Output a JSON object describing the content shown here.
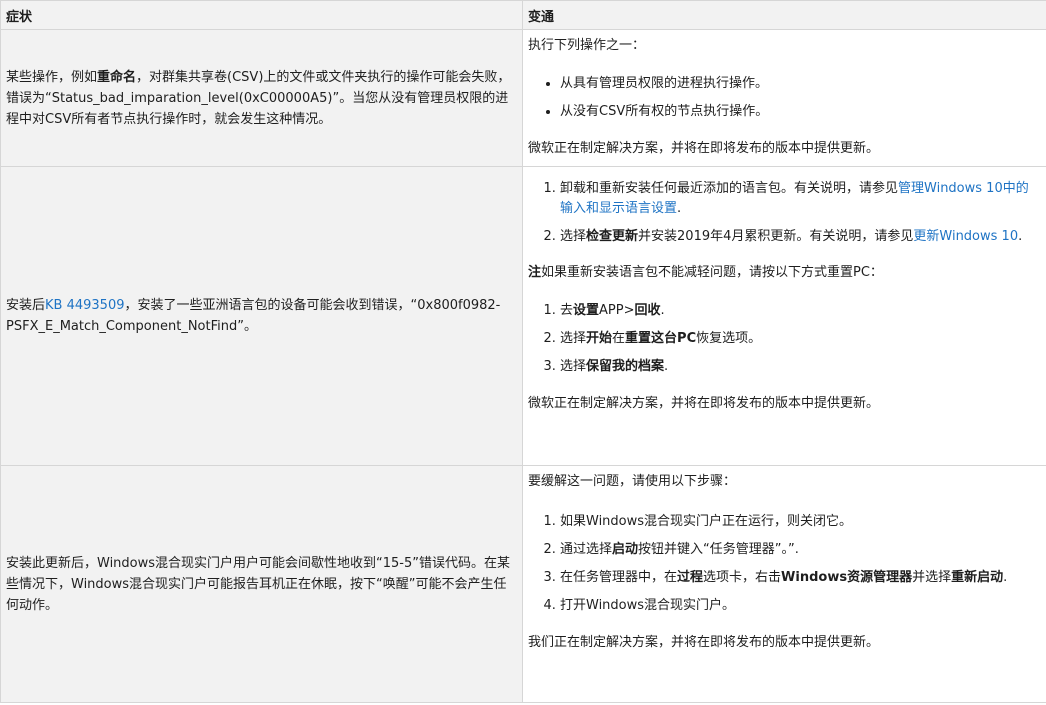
{
  "header": {
    "symptom": "症状",
    "workaround": "变通"
  },
  "row1": {
    "symptom": {
      "a": "某些操作，例如",
      "b": "重命名",
      "c": "，对群集共享卷(CSV)上的文件或文件夹执行的操作可能会失败，错误为“Status_bad_imparation_level(0xC00000A5)”。当您从没有管理员权限的进程中对CSV所有者节点执行操作时，就会发生这种情况。"
    },
    "workaround": {
      "intro": "执行下列操作之一：",
      "bullets": [
        "从具有管理员权限的进程执行操作。",
        "从没有CSV所有权的节点执行操作。"
      ],
      "footer": "微软正在制定解决方案，并将在即将发布的版本中提供更新。"
    }
  },
  "row2": {
    "symptom": {
      "a": "安装后",
      "link": "KB 4493509",
      "b": "，安装了一些亚洲语言包的设备可能会收到错误，“0x800f0982-PSFX_E_Match_Component_NotFind”。"
    },
    "workaround": {
      "s1_a": "卸载和重新安装任何最近添加的语言包。有关说明，请参见",
      "s1_link": "管理Windows 10中的输入和显示语言设置",
      "s1_b": ".",
      "s2_a": "选择",
      "s2_bold": "检查更新",
      "s2_b": "并安装2019年4月累积更新。有关说明，请参见",
      "s2_link": "更新Windows 10",
      "s2_c": ".",
      "note_bold": "注",
      "note_rest": "如果重新安装语言包不能减轻问题，请按以下方式重置PC：",
      "r1_a": "去",
      "r1_b1": "设置",
      "r1_c": "APP>",
      "r1_b2": "回收",
      "r1_d": ".",
      "r2_a": "选择",
      "r2_b1": "开始",
      "r2_c": "在",
      "r2_b2": "重置这台PC",
      "r2_d": "恢复选项。",
      "r3_a": "选择",
      "r3_b": "保留我的档案",
      "r3_c": ".",
      "footer": "微软正在制定解决方案，并将在即将发布的版本中提供更新。"
    }
  },
  "row3": {
    "symptom": {
      "text": "安装此更新后，Windows混合现实门户用户可能会间歇性地收到“15-5”错误代码。在某些情况下，Windows混合现实门户可能报告耳机正在休眠，按下“唤醒”可能不会产生任何动作。"
    },
    "workaround": {
      "intro": "要缓解这一问题，请使用以下步骤：",
      "s1": "如果Windows混合现实门户正在运行，则关闭它。",
      "s2_a": "通过选择",
      "s2_b": "启动",
      "s2_c": "按钮并键入“任务管理器”。”.",
      "s3_a": "在任务管理器中，在",
      "s3_b1": "过程",
      "s3_c": "选项卡，右击",
      "s3_b2": "Windows资源管理器",
      "s3_d": "并选择",
      "s3_b3": "重新启动",
      "s3_e": ".",
      "s4": "打开Windows混合现实门户。",
      "footer": "我们正在制定解决方案，并将在即将发布的版本中提供更新。"
    }
  }
}
